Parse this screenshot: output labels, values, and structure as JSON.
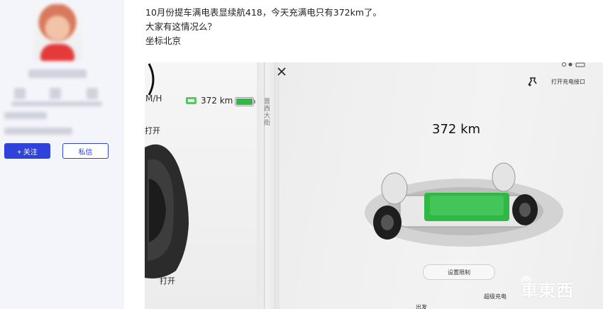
{
  "sidebar": {
    "follow_label": "+ 关注",
    "message_label": "私信"
  },
  "post": {
    "lines": [
      "10月份提车满电表显续航418，今天充满电只有372km了。",
      "大家有这情况么？",
      "坐标北京"
    ]
  },
  "photo": {
    "speed_unit_fragment": "M/H",
    "status_range": "372 km",
    "open_label_top": "打开",
    "open_label_bottom": "打开",
    "map_label": "晋西大街",
    "main_range": "372 km",
    "charge_port_label": "打开充电接口",
    "set_limit_label": "设置限制",
    "supercharge_label": "超级充电",
    "bottom_fragment": "出发",
    "watermark": "車東西",
    "battery_color": "#2fb843"
  }
}
